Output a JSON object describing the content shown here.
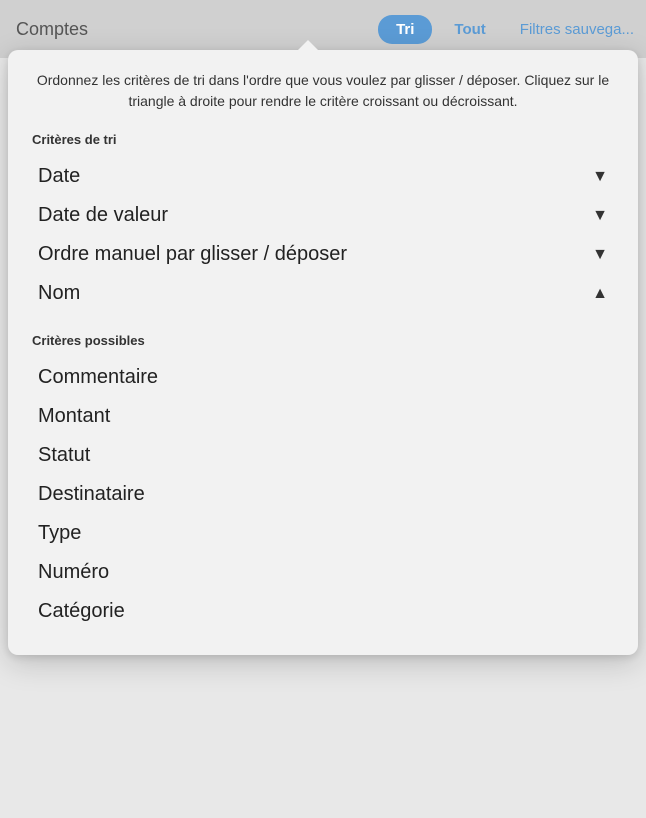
{
  "topBar": {
    "title": "Comptes",
    "buttons": [
      {
        "label": "Tri",
        "active": true
      },
      {
        "label": "Tout",
        "active": false
      }
    ],
    "filtresLabel": "Filtres sauvega..."
  },
  "dropdown": {
    "description": "Ordonnez les critères de tri dans l'ordre que vous voulez par glisser / déposer. Cliquez sur le triangle à droite pour rendre le critère croissant ou décroissant.",
    "activeSection": {
      "label": "Critères de tri",
      "items": [
        {
          "label": "Date",
          "direction": "down"
        },
        {
          "label": "Date de valeur",
          "direction": "down"
        },
        {
          "label": "Ordre manuel par glisser / déposer",
          "direction": "down"
        },
        {
          "label": "Nom",
          "direction": "up"
        }
      ]
    },
    "possibleSection": {
      "label": "Critères possibles",
      "items": [
        {
          "label": "Commentaire"
        },
        {
          "label": "Montant"
        },
        {
          "label": "Statut"
        },
        {
          "label": "Destinataire"
        },
        {
          "label": "Type"
        },
        {
          "label": "Numéro"
        },
        {
          "label": "Catégorie"
        }
      ]
    }
  }
}
